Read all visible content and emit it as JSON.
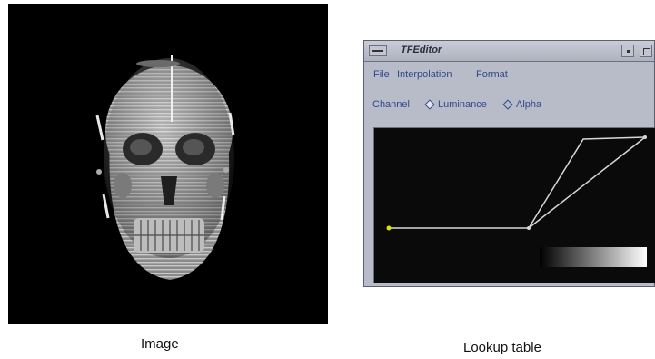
{
  "captions": {
    "image": "Image",
    "lookup_table": "Lookup table"
  },
  "render_view": {
    "subject": "volume-rendered skull",
    "background": "#000000"
  },
  "tf_editor": {
    "title": "TFEditor",
    "menu": {
      "file": "File",
      "interpolation": "Interpolation",
      "format": "Format"
    },
    "channel": {
      "label": "Channel",
      "options": [
        "Luminance",
        "Alpha"
      ],
      "selected": "Luminance"
    },
    "colors": {
      "window_bg": "#b8bcc8",
      "text": "#32478e",
      "canvas_bg": "#0a0a0a",
      "curve": "#d8d8d8",
      "control_point": "#e0e000"
    }
  }
}
